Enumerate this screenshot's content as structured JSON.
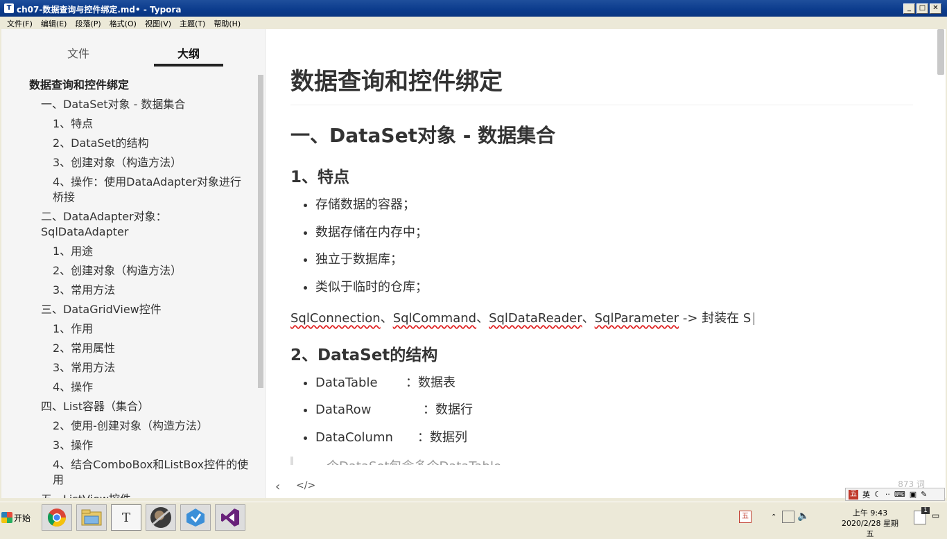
{
  "window": {
    "title": "ch07-数据查询与控件绑定.md• - Typora",
    "app_icon": "T"
  },
  "menu": [
    "文件(F)",
    "编辑(E)",
    "段落(P)",
    "格式(O)",
    "视图(V)",
    "主题(T)",
    "帮助(H)"
  ],
  "sidebar": {
    "tab_files": "文件",
    "tab_outline": "大纲",
    "outline": [
      {
        "level": 1,
        "text": "数据查询和控件绑定"
      },
      {
        "level": 2,
        "text": "一、DataSet对象 - 数据集合"
      },
      {
        "level": 3,
        "text": "1、特点"
      },
      {
        "level": 3,
        "text": "2、DataSet的结构"
      },
      {
        "level": 3,
        "text": "3、创建对象（构造方法）"
      },
      {
        "level": 3,
        "text": "4、操作：使用DataAdapter对象进行桥接"
      },
      {
        "level": 2,
        "text": "二、DataAdapter对象：SqlDataAdapter"
      },
      {
        "level": 3,
        "text": "1、用途"
      },
      {
        "level": 3,
        "text": "2、创建对象（构造方法）"
      },
      {
        "level": 3,
        "text": "3、常用方法"
      },
      {
        "level": 2,
        "text": "三、DataGridView控件"
      },
      {
        "level": 3,
        "text": "1、作用"
      },
      {
        "level": 3,
        "text": "2、常用属性"
      },
      {
        "level": 3,
        "text": "3、常用方法"
      },
      {
        "level": 3,
        "text": "4、操作"
      },
      {
        "level": 2,
        "text": "四、List容器（集合）"
      },
      {
        "level": 3,
        "text": "2、使用-创建对象（构造方法）"
      },
      {
        "level": 3,
        "text": "3、操作"
      },
      {
        "level": 3,
        "text": "4、结合ComboBox和ListBox控件的使用"
      },
      {
        "level": 2,
        "text": "五、ListView控件"
      }
    ]
  },
  "doc": {
    "h1": "数据查询和控件绑定",
    "h2_1": "一、DataSet对象 - 数据集合",
    "h3_1": "1、特点",
    "bullets_1": [
      "存储数据的容器；",
      "数据存储在内存中；",
      "独立于数据库；",
      "类似于临时的仓库；"
    ],
    "para": {
      "t1": "SqlConnection",
      "sep1": "、",
      "t2": "SqlCommand",
      "sep2": "、",
      "t3": "SqlDataReader",
      "sep3": "、",
      "t4": "SqlParameter",
      "tail": " -> 封装在 S"
    },
    "h3_2": "2、DataSet的结构",
    "bullets_2": [
      {
        "key": "DataTable",
        "val": "：数据表"
      },
      {
        "key": "DataRow",
        "val": "：数据行"
      },
      {
        "key": "DataColumn",
        "val": "：数据列"
      }
    ],
    "quote_partial": "一个DataSet包含多个DataTable"
  },
  "footer": {
    "back": "‹",
    "source_toggle": "</>",
    "word_count": "873 词"
  },
  "ime": {
    "logo": "五",
    "lang": "英",
    "icons": [
      "moon-icon",
      "dots-icon",
      "keyboard-icon",
      "shirt-icon",
      "wrench-icon"
    ]
  },
  "taskbar": {
    "start": "开始",
    "apps": [
      "chrome-icon",
      "explorer-icon",
      "typora-icon",
      "game-icon",
      "vs-installer-icon",
      "visual-studio-icon"
    ],
    "clock_time": "上午 9:43",
    "clock_date": "2020/2/28 星期五",
    "notif_count": "1",
    "ime_tray": "五"
  }
}
